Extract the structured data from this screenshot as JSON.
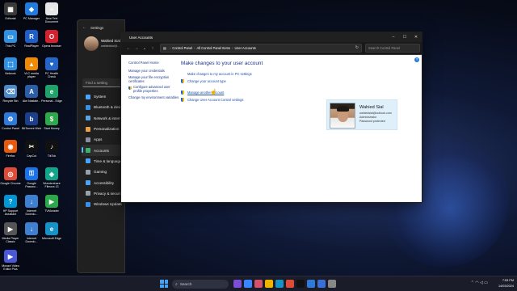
{
  "desktop": {
    "icons": [
      {
        "label": "Editorial",
        "color": "#3a3a3a",
        "glyph": "▦",
        "icon": "editorial-icon"
      },
      {
        "label": "PC Manager",
        "color": "#1f7be0",
        "glyph": "◆",
        "icon": "pc-manager-icon"
      },
      {
        "label": "New Text Document",
        "color": "#e6e6e6",
        "glyph": "≡",
        "icon": "text-document-icon"
      },
      {
        "label": "This PC",
        "color": "#2f8fe0",
        "glyph": "▭",
        "icon": "this-pc-icon"
      },
      {
        "label": "RealPlayer",
        "color": "#1d5ec8",
        "glyph": "R",
        "icon": "realplayer-icon"
      },
      {
        "label": "Opera browser",
        "color": "#d4212e",
        "glyph": "O",
        "icon": "opera-icon"
      },
      {
        "label": "Network",
        "color": "#2f8fe0",
        "glyph": "⬚",
        "icon": "network-icon"
      },
      {
        "label": "VLC media player",
        "color": "#f08a00",
        "glyph": "▲",
        "icon": "vlc-icon"
      },
      {
        "label": "PC Health Check",
        "color": "#2466c8",
        "glyph": "♥",
        "icon": "pc-health-check-icon"
      },
      {
        "label": "Recycle Bin",
        "color": "#4c89c7",
        "glyph": "⌫",
        "icon": "recycle-bin-icon"
      },
      {
        "label": "Akri Nastale...",
        "color": "#2a5fa8",
        "glyph": "A",
        "icon": "akri-nastaleeq-icon"
      },
      {
        "label": "Personal - Edge",
        "color": "#1fa36a",
        "glyph": "e",
        "icon": "edge-personal-icon"
      },
      {
        "label": "Control Panel",
        "color": "#2f79d8",
        "glyph": "⚙",
        "icon": "control-panel-icon"
      },
      {
        "label": "BitTorrent Web",
        "color": "#1c3f8c",
        "glyph": "b",
        "icon": "bittorrent-icon"
      },
      {
        "label": "Start Money",
        "color": "#2fa84b",
        "glyph": "$",
        "icon": "start-money-icon"
      },
      {
        "label": "Firefox",
        "color": "#e8590c",
        "glyph": "◉",
        "icon": "firefox-icon"
      },
      {
        "label": "CapCut",
        "color": "#111111",
        "glyph": "✂",
        "icon": "capcut-icon"
      },
      {
        "label": "TikTok",
        "color": "#111111",
        "glyph": "♪",
        "icon": "tiktok-icon"
      },
      {
        "label": "Google Chrome",
        "color": "#dd4b39",
        "glyph": "◎",
        "icon": "chrome-icon"
      },
      {
        "label": "Google Passwo...",
        "color": "#1a73e8",
        "glyph": "⚿",
        "icon": "google-password-icon"
      },
      {
        "label": "Wondershare Filmora 13",
        "color": "#12a58c",
        "glyph": "◈",
        "icon": "filmora-icon"
      },
      {
        "label": "HP Support Assistant",
        "color": "#0096d6",
        "glyph": "?",
        "icon": "hp-support-icon"
      },
      {
        "label": "Internet Downlo...",
        "color": "#3f7fd0",
        "glyph": "↓",
        "icon": "internet-download-icon"
      },
      {
        "label": "TVMonster",
        "color": "#2aa84a",
        "glyph": "▶",
        "icon": "tvmonster-icon"
      },
      {
        "label": "Media Player Classic",
        "color": "#555555",
        "glyph": "▶",
        "icon": "media-player-classic-icon"
      },
      {
        "label": "Internet Downlo...",
        "color": "#3f7fd0",
        "glyph": "↓",
        "icon": "internet-download-icon"
      },
      {
        "label": "Microsoft Edge",
        "color": "#1593c6",
        "glyph": "e",
        "icon": "edge-icon"
      },
      {
        "label": "Movavi Video Editor Plus",
        "color": "#4a58d6",
        "glyph": "▶",
        "icon": "movavi-icon"
      }
    ]
  },
  "settings": {
    "title": "Settings",
    "user_name": "Wahied Sial",
    "user_email": "wahiedsial@...",
    "search_placeholder": "Find a setting",
    "nav": [
      {
        "label": "System",
        "color": "#4aa3ff",
        "icon": "system-icon"
      },
      {
        "label": "Bluetooth & devices",
        "color": "#3b8fe6",
        "icon": "bluetooth-icon"
      },
      {
        "label": "Network & internet",
        "color": "#5aa5e8",
        "icon": "network-icon"
      },
      {
        "label": "Personalization",
        "color": "#e8a04a",
        "icon": "personalization-icon"
      },
      {
        "label": "Apps",
        "color": "#8a8fa0",
        "icon": "apps-icon"
      },
      {
        "label": "Accounts",
        "color": "#3cb371",
        "icon": "accounts-icon"
      },
      {
        "label": "Time & language",
        "color": "#4aa3ff",
        "icon": "time-language-icon"
      },
      {
        "label": "Gaming",
        "color": "#9aa0ab",
        "icon": "gaming-icon"
      },
      {
        "label": "Accessibility",
        "color": "#4aa3ff",
        "icon": "accessibility-icon"
      },
      {
        "label": "Privacy & security",
        "color": "#9aa0ab",
        "icon": "privacy-icon"
      },
      {
        "label": "Windows Update",
        "color": "#3b8fe6",
        "icon": "windows-update-icon"
      }
    ],
    "active_index": 5
  },
  "user_accounts": {
    "window_title": "User Accounts",
    "address": [
      "Control Panel",
      "All Control Panel Items",
      "User Accounts"
    ],
    "search_placeholder": "Search Control Panel",
    "left_home": "Control Panel Home",
    "left_tasks": [
      "Manage your credentials",
      "Manage your file encryption certificates",
      "Configure advanced user profile properties",
      "Change my environment variables"
    ],
    "heading": "Make changes to your user account",
    "links": [
      "Make changes to my account in PC settings",
      "Change your account type",
      "Manage another account",
      "Change User Account Control settings"
    ],
    "card": {
      "name": "Wahied Sial",
      "email": "wahiedsial@outlook.com",
      "role": "Administrator",
      "status": "Password protected"
    }
  },
  "taskbar": {
    "search_placeholder": "Search",
    "apps": [
      {
        "color": "#7a4fd6",
        "icon": "app-icon"
      },
      {
        "color": "#3a86ff",
        "icon": "app-icon"
      },
      {
        "color": "#d64f6b",
        "icon": "app-icon"
      },
      {
        "color": "#f0b400",
        "icon": "file-explorer-icon"
      },
      {
        "color": "#1593c6",
        "icon": "edge-icon"
      },
      {
        "color": "#dd4b39",
        "icon": "chrome-icon"
      },
      {
        "color": "#111111",
        "icon": "app-icon"
      },
      {
        "color": "#2f79d8",
        "icon": "control-panel-icon"
      },
      {
        "color": "#3a6fd8",
        "icon": "app-icon"
      },
      {
        "color": "#888888",
        "icon": "settings-icon"
      }
    ],
    "time": "7:53 PM",
    "date": "14/03/2024"
  }
}
